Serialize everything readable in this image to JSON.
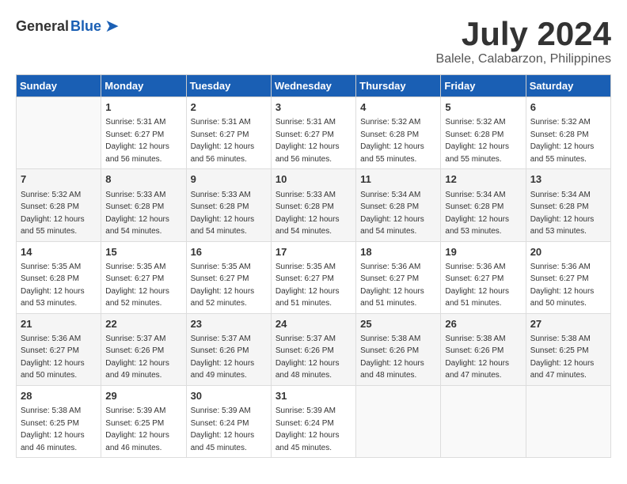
{
  "header": {
    "logo_general": "General",
    "logo_blue": "Blue",
    "title": "July 2024",
    "subtitle": "Balele, Calabarzon, Philippines"
  },
  "calendar": {
    "days_of_week": [
      "Sunday",
      "Monday",
      "Tuesday",
      "Wednesday",
      "Thursday",
      "Friday",
      "Saturday"
    ],
    "weeks": [
      [
        {
          "day": "",
          "info": ""
        },
        {
          "day": "1",
          "info": "Sunrise: 5:31 AM\nSunset: 6:27 PM\nDaylight: 12 hours\nand 56 minutes."
        },
        {
          "day": "2",
          "info": "Sunrise: 5:31 AM\nSunset: 6:27 PM\nDaylight: 12 hours\nand 56 minutes."
        },
        {
          "day": "3",
          "info": "Sunrise: 5:31 AM\nSunset: 6:27 PM\nDaylight: 12 hours\nand 56 minutes."
        },
        {
          "day": "4",
          "info": "Sunrise: 5:32 AM\nSunset: 6:28 PM\nDaylight: 12 hours\nand 55 minutes."
        },
        {
          "day": "5",
          "info": "Sunrise: 5:32 AM\nSunset: 6:28 PM\nDaylight: 12 hours\nand 55 minutes."
        },
        {
          "day": "6",
          "info": "Sunrise: 5:32 AM\nSunset: 6:28 PM\nDaylight: 12 hours\nand 55 minutes."
        }
      ],
      [
        {
          "day": "7",
          "info": "Sunrise: 5:32 AM\nSunset: 6:28 PM\nDaylight: 12 hours\nand 55 minutes."
        },
        {
          "day": "8",
          "info": "Sunrise: 5:33 AM\nSunset: 6:28 PM\nDaylight: 12 hours\nand 54 minutes."
        },
        {
          "day": "9",
          "info": "Sunrise: 5:33 AM\nSunset: 6:28 PM\nDaylight: 12 hours\nand 54 minutes."
        },
        {
          "day": "10",
          "info": "Sunrise: 5:33 AM\nSunset: 6:28 PM\nDaylight: 12 hours\nand 54 minutes."
        },
        {
          "day": "11",
          "info": "Sunrise: 5:34 AM\nSunset: 6:28 PM\nDaylight: 12 hours\nand 54 minutes."
        },
        {
          "day": "12",
          "info": "Sunrise: 5:34 AM\nSunset: 6:28 PM\nDaylight: 12 hours\nand 53 minutes."
        },
        {
          "day": "13",
          "info": "Sunrise: 5:34 AM\nSunset: 6:28 PM\nDaylight: 12 hours\nand 53 minutes."
        }
      ],
      [
        {
          "day": "14",
          "info": "Sunrise: 5:35 AM\nSunset: 6:28 PM\nDaylight: 12 hours\nand 53 minutes."
        },
        {
          "day": "15",
          "info": "Sunrise: 5:35 AM\nSunset: 6:27 PM\nDaylight: 12 hours\nand 52 minutes."
        },
        {
          "day": "16",
          "info": "Sunrise: 5:35 AM\nSunset: 6:27 PM\nDaylight: 12 hours\nand 52 minutes."
        },
        {
          "day": "17",
          "info": "Sunrise: 5:35 AM\nSunset: 6:27 PM\nDaylight: 12 hours\nand 51 minutes."
        },
        {
          "day": "18",
          "info": "Sunrise: 5:36 AM\nSunset: 6:27 PM\nDaylight: 12 hours\nand 51 minutes."
        },
        {
          "day": "19",
          "info": "Sunrise: 5:36 AM\nSunset: 6:27 PM\nDaylight: 12 hours\nand 51 minutes."
        },
        {
          "day": "20",
          "info": "Sunrise: 5:36 AM\nSunset: 6:27 PM\nDaylight: 12 hours\nand 50 minutes."
        }
      ],
      [
        {
          "day": "21",
          "info": "Sunrise: 5:36 AM\nSunset: 6:27 PM\nDaylight: 12 hours\nand 50 minutes."
        },
        {
          "day": "22",
          "info": "Sunrise: 5:37 AM\nSunset: 6:26 PM\nDaylight: 12 hours\nand 49 minutes."
        },
        {
          "day": "23",
          "info": "Sunrise: 5:37 AM\nSunset: 6:26 PM\nDaylight: 12 hours\nand 49 minutes."
        },
        {
          "day": "24",
          "info": "Sunrise: 5:37 AM\nSunset: 6:26 PM\nDaylight: 12 hours\nand 48 minutes."
        },
        {
          "day": "25",
          "info": "Sunrise: 5:38 AM\nSunset: 6:26 PM\nDaylight: 12 hours\nand 48 minutes."
        },
        {
          "day": "26",
          "info": "Sunrise: 5:38 AM\nSunset: 6:26 PM\nDaylight: 12 hours\nand 47 minutes."
        },
        {
          "day": "27",
          "info": "Sunrise: 5:38 AM\nSunset: 6:25 PM\nDaylight: 12 hours\nand 47 minutes."
        }
      ],
      [
        {
          "day": "28",
          "info": "Sunrise: 5:38 AM\nSunset: 6:25 PM\nDaylight: 12 hours\nand 46 minutes."
        },
        {
          "day": "29",
          "info": "Sunrise: 5:39 AM\nSunset: 6:25 PM\nDaylight: 12 hours\nand 46 minutes."
        },
        {
          "day": "30",
          "info": "Sunrise: 5:39 AM\nSunset: 6:24 PM\nDaylight: 12 hours\nand 45 minutes."
        },
        {
          "day": "31",
          "info": "Sunrise: 5:39 AM\nSunset: 6:24 PM\nDaylight: 12 hours\nand 45 minutes."
        },
        {
          "day": "",
          "info": ""
        },
        {
          "day": "",
          "info": ""
        },
        {
          "day": "",
          "info": ""
        }
      ]
    ]
  }
}
